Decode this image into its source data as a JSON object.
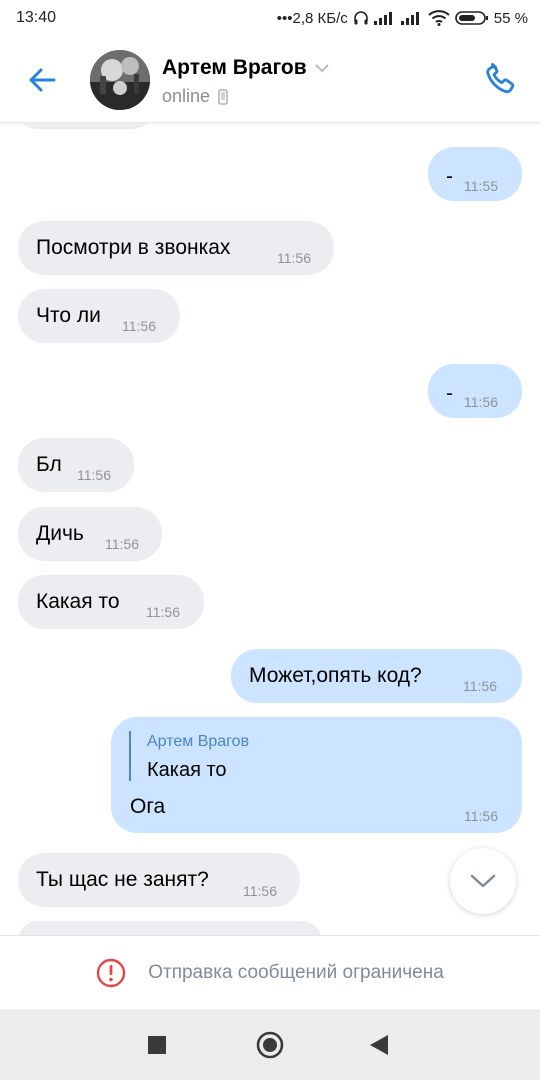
{
  "status_bar": {
    "time": "13:40",
    "network_speed": "•••2,8 КБ/с",
    "battery_percent": "55 %"
  },
  "header": {
    "contact_name": "Артем Врагов",
    "status": "online",
    "back_icon": "arrow-left-icon",
    "call_icon": "phone-icon"
  },
  "messages": [
    {
      "dir": "out",
      "text": "-",
      "time": "11:55"
    },
    {
      "dir": "in",
      "text": "Посмотри в звонках",
      "time": "11:56"
    },
    {
      "dir": "in",
      "text": "Что ли",
      "time": "11:56"
    },
    {
      "dir": "out",
      "text": "-",
      "time": "11:56"
    },
    {
      "dir": "in",
      "text": "Бл",
      "time": "11:56"
    },
    {
      "dir": "in",
      "text": "Дичь",
      "time": "11:56"
    },
    {
      "dir": "in",
      "text": "Какая то",
      "time": "11:56"
    },
    {
      "dir": "out",
      "text": "Может,опять код?",
      "time": "11:56"
    },
    {
      "dir": "out",
      "reply_author": "Артем Врагов",
      "reply_text": "Какая то",
      "text": "Ога",
      "time": "11:56"
    },
    {
      "dir": "in",
      "text": "Ты щас не занят?",
      "time": "11:56"
    }
  ],
  "footer": {
    "restriction_text": "Отправка сообщений ограничена"
  },
  "colors": {
    "accent": "#2a81d8",
    "incoming_bubble": "#ebedf0",
    "outgoing_bubble": "#cce4ff",
    "reply_author": "#4a86c5",
    "warning": "#e64646"
  }
}
